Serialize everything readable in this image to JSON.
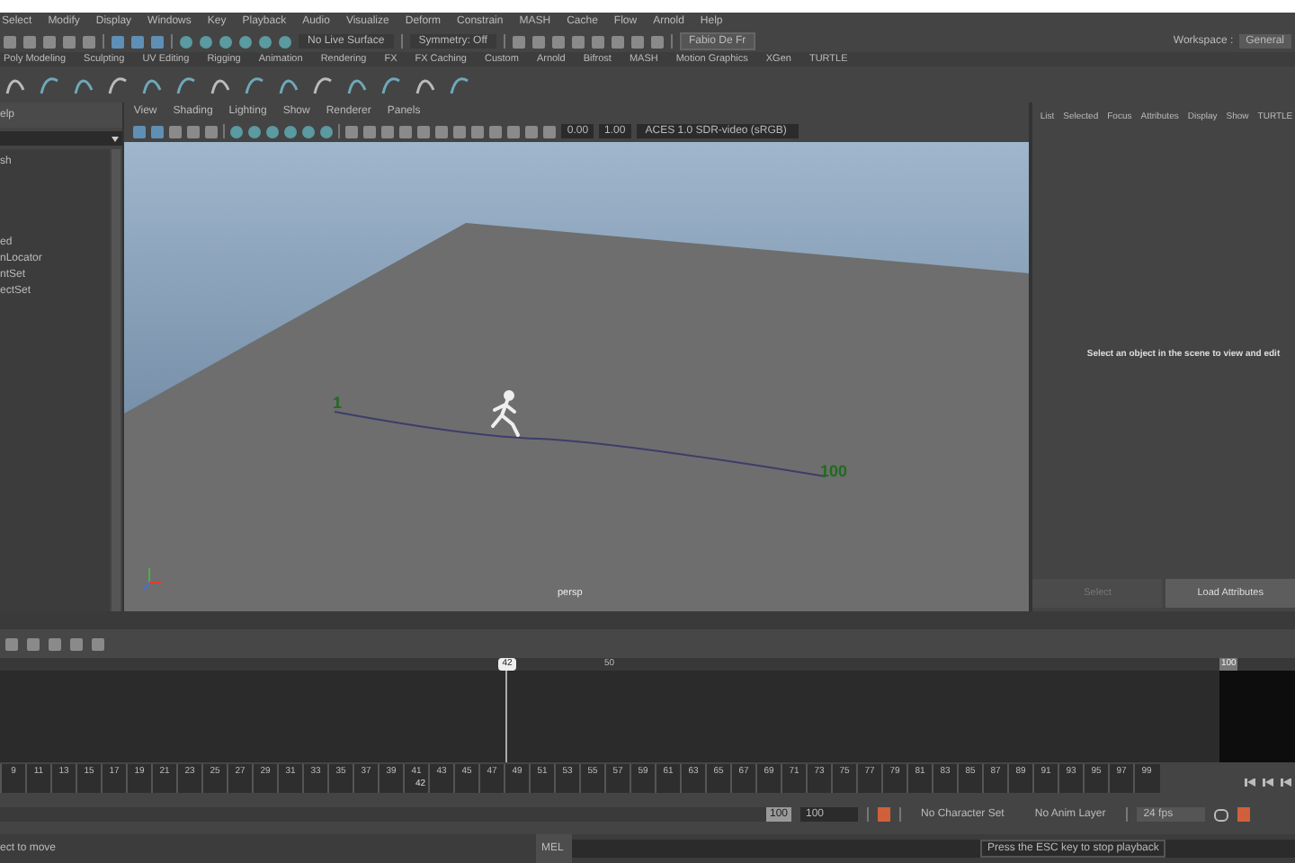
{
  "menubar": {
    "items": [
      "Select",
      "Modify",
      "Display",
      "Windows",
      "Key",
      "Playback",
      "Audio",
      "Visualize",
      "Deform",
      "Constrain",
      "MASH",
      "Cache",
      "Flow",
      "Arnold",
      "Help"
    ]
  },
  "toolbar": {
    "live_surface": "No Live Surface",
    "symmetry": "Symmetry: Off",
    "user": "Fabio De Fr",
    "workspace_label": "Workspace :",
    "workspace_value": "General"
  },
  "shelf": {
    "tabs": [
      "Poly Modeling",
      "Sculpting",
      "UV Editing",
      "Rigging",
      "Animation",
      "Rendering",
      "FX",
      "FX Caching",
      "Custom",
      "Arnold",
      "Bifrost",
      "MASH",
      "Motion Graphics",
      "XGen",
      "TURTLE"
    ]
  },
  "outliner": {
    "header": "elp",
    "items_top": [
      "sh"
    ],
    "items": [
      "ed",
      "nLocator",
      "ntSet",
      "ectSet"
    ]
  },
  "viewport": {
    "menus": [
      "View",
      "Shading",
      "Lighting",
      "Show",
      "Renderer",
      "Panels"
    ],
    "exposure": "0.00",
    "gamma": "1.00",
    "color_space": "ACES 1.0 SDR-video (sRGB)",
    "start_marker": "1",
    "end_marker": "100",
    "camera": "persp"
  },
  "attribute_editor": {
    "tabs": [
      "List",
      "Selected",
      "Focus",
      "Attributes",
      "Display",
      "Show",
      "TURTLE"
    ],
    "message": "Select an object in the scene to view and edit",
    "buttons": [
      {
        "label": "Select",
        "disabled": true
      },
      {
        "label": "Load Attributes",
        "disabled": false
      }
    ]
  },
  "time_slider": {
    "current": "42",
    "ticks": [
      "50"
    ],
    "end": "100",
    "ruler": [
      "9",
      "11",
      "13",
      "15",
      "17",
      "19",
      "21",
      "23",
      "25",
      "27",
      "29",
      "31",
      "33",
      "35",
      "37",
      "39",
      "41",
      "43",
      "45",
      "47",
      "49",
      "51",
      "53",
      "55",
      "57",
      "59",
      "61",
      "63",
      "65",
      "67",
      "69",
      "71",
      "73",
      "75",
      "77",
      "79",
      "81",
      "83",
      "85",
      "87",
      "89",
      "91",
      "93",
      "95",
      "97",
      "99"
    ],
    "ruler_current": "42"
  },
  "range": {
    "level": 1,
    "end": "100",
    "end_field": "100",
    "character_set": "No Character Set",
    "anim_layer": "No Anim Layer",
    "fps": "24 fps"
  },
  "status": {
    "help": "ect to move",
    "language": "MEL",
    "tooltip": "Press the ESC key to stop playback"
  }
}
